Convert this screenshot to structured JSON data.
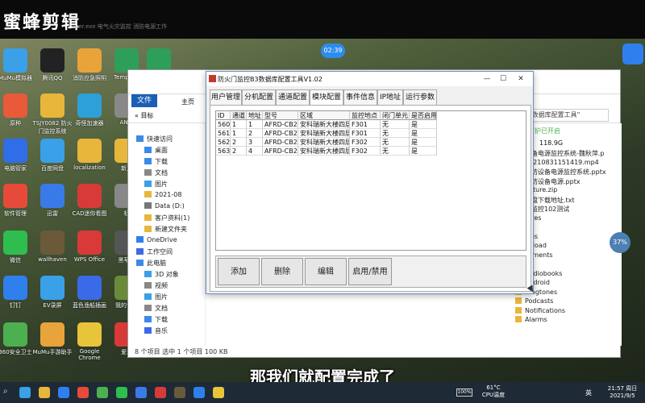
{
  "video": {
    "watermark": "蜜蜂剪辑",
    "rec_time": "02:39",
    "subtitle": "那我们就配置完成了",
    "top_ghost": "ruer.exe  电气火灾监控    消防电源工作"
  },
  "desktop_icons": [
    {
      "label": "MuMu模拟器",
      "color": "#3aa0e8"
    },
    {
      "label": "腾讯QQ",
      "color": "#222222"
    },
    {
      "label": "消防应急照明",
      "color": "#e8a43a"
    },
    {
      "label": "Template",
      "color": "#2e9e5b"
    },
    {
      "label": "新建 XLSX 工",
      "color": "#2e9e5b"
    },
    {
      "label": "原种",
      "color": "#e85a3a"
    },
    {
      "label": "TSJY0082 防火门监控系统",
      "color": "#e8b63b"
    },
    {
      "label": "奇怪加速器",
      "color": "#2ea0d8"
    },
    {
      "label": "ANet",
      "color": "#888888"
    },
    {
      "label": "电脑管家",
      "color": "#2f6ee8"
    },
    {
      "label": "百度网盘",
      "color": "#3aa0e8"
    },
    {
      "label": "localization",
      "color": "#e8b63b"
    },
    {
      "label": "新加",
      "color": "#e8b63b"
    },
    {
      "label": "软件管理",
      "color": "#e84a3a"
    },
    {
      "label": "迅雷",
      "color": "#3a7ae8"
    },
    {
      "label": "CAD迷你看图",
      "color": "#d83a3a"
    },
    {
      "label": "标",
      "color": "#888888"
    },
    {
      "label": "微信",
      "color": "#2ebd4e"
    },
    {
      "label": "wallhaven",
      "color": "#6a5a3a"
    },
    {
      "label": "WPS Office",
      "color": "#d83a3a"
    },
    {
      "label": "黑苹果",
      "color": "#555555"
    },
    {
      "label": "钉钉",
      "color": "#2f80ed"
    },
    {
      "label": "EV录屏",
      "color": "#3aa0e8"
    },
    {
      "label": "蓝色渔船插画",
      "color": "#3a6ae8"
    },
    {
      "label": "我的世界",
      "color": "#6a8a3a"
    },
    {
      "label": "360安全卫士",
      "color": "#4caf50"
    },
    {
      "label": "MuMu手游助手",
      "color": "#e8a43a"
    },
    {
      "label": "Google Chrome",
      "color": "#e8c43a"
    },
    {
      "label": "爱动",
      "color": "#d83a3a"
    }
  ],
  "explorer": {
    "tabs": {
      "file": "文件",
      "home": "主页",
      "share": "共享"
    },
    "address": "« 目标",
    "search_placeholder": "搜索\"数据库配置工具\"",
    "security": "安全防护已开启",
    "size": "118.9G",
    "nav": [
      {
        "label": "快速访问",
        "icon": "star-icon"
      },
      {
        "label": "桌面",
        "icon": "desktop-icon"
      },
      {
        "label": "下载",
        "icon": "download-icon"
      },
      {
        "label": "文档",
        "icon": "document-icon"
      },
      {
        "label": "图片",
        "icon": "picture-icon"
      },
      {
        "label": "2021-08",
        "icon": "folder-icon"
      },
      {
        "label": "Data (D:)",
        "icon": "drive-icon"
      },
      {
        "label": "客户资料(1)",
        "icon": "folder-icon"
      },
      {
        "label": "新建文件夹",
        "icon": "folder-icon"
      },
      {
        "label": "OneDrive",
        "icon": "cloud-icon"
      },
      {
        "label": "工作空间",
        "icon": "workspace-icon"
      },
      {
        "label": "此电脑",
        "icon": "pc-icon"
      },
      {
        "label": "3D 对象",
        "icon": "cube-icon"
      },
      {
        "label": "视频",
        "icon": "video-icon"
      },
      {
        "label": "图片",
        "icon": "picture-icon"
      },
      {
        "label": "文档",
        "icon": "document-icon"
      },
      {
        "label": "下载",
        "icon": "download-icon"
      },
      {
        "label": "音乐",
        "icon": "music-icon"
      }
    ],
    "right_items": [
      "设备电源监控系统-魏秋萍.p",
      "20210831151419.mp4",
      "消防设备电源监控系统.pptx",
      "消防设备电源.pptx",
      "apture.zip",
      "网盘下载地址.txt",
      "电监控102测试",
      "tures",
      "sic",
      "vies",
      "vnload",
      "cuments",
      "M",
      "Audiobooks",
      "Android",
      "Ringtones",
      "Podcasts",
      "Notifications",
      "Alarms"
    ],
    "status": "8 个项目    选中 1 个项目  100 KB"
  },
  "app": {
    "title": "防火门监控B3数据库配置工具V1.02",
    "tabs": [
      "用户管理",
      "分机配置",
      "通道配置",
      "模块配置",
      "事件信息",
      "IP地址",
      "运行参数"
    ],
    "active_tab": 3,
    "columns": [
      "ID",
      "通道",
      "地址",
      "型号",
      "区域",
      "监控地点",
      "闭门单元",
      "是否启用"
    ],
    "rows": [
      [
        "560",
        "1",
        "1",
        "AFRD-CB2",
        "安科瑞新大楼四层",
        "F301",
        "无",
        "是"
      ],
      [
        "561",
        "1",
        "2",
        "AFRD-CB2",
        "安科瑞新大楼四层",
        "F301",
        "无",
        "是"
      ],
      [
        "562",
        "2",
        "3",
        "AFRD-CB2",
        "安科瑞新大楼四层",
        "F302",
        "无",
        "是"
      ],
      [
        "563",
        "2",
        "4",
        "AFRD-CB2",
        "安科瑞新大楼四层",
        "F302",
        "无",
        "是"
      ]
    ],
    "buttons": {
      "add": "添加",
      "delete": "删除",
      "edit": "编辑",
      "toggle": "启用/禁用"
    }
  },
  "widgets": {
    "weather": "37%"
  },
  "taskbar": {
    "search_glyph": "⌕",
    "battery": "100%",
    "cpu_temp": "61°C\nCPU温度",
    "ime": "英",
    "time": "21:57 周日",
    "date": "2021/9/5"
  }
}
